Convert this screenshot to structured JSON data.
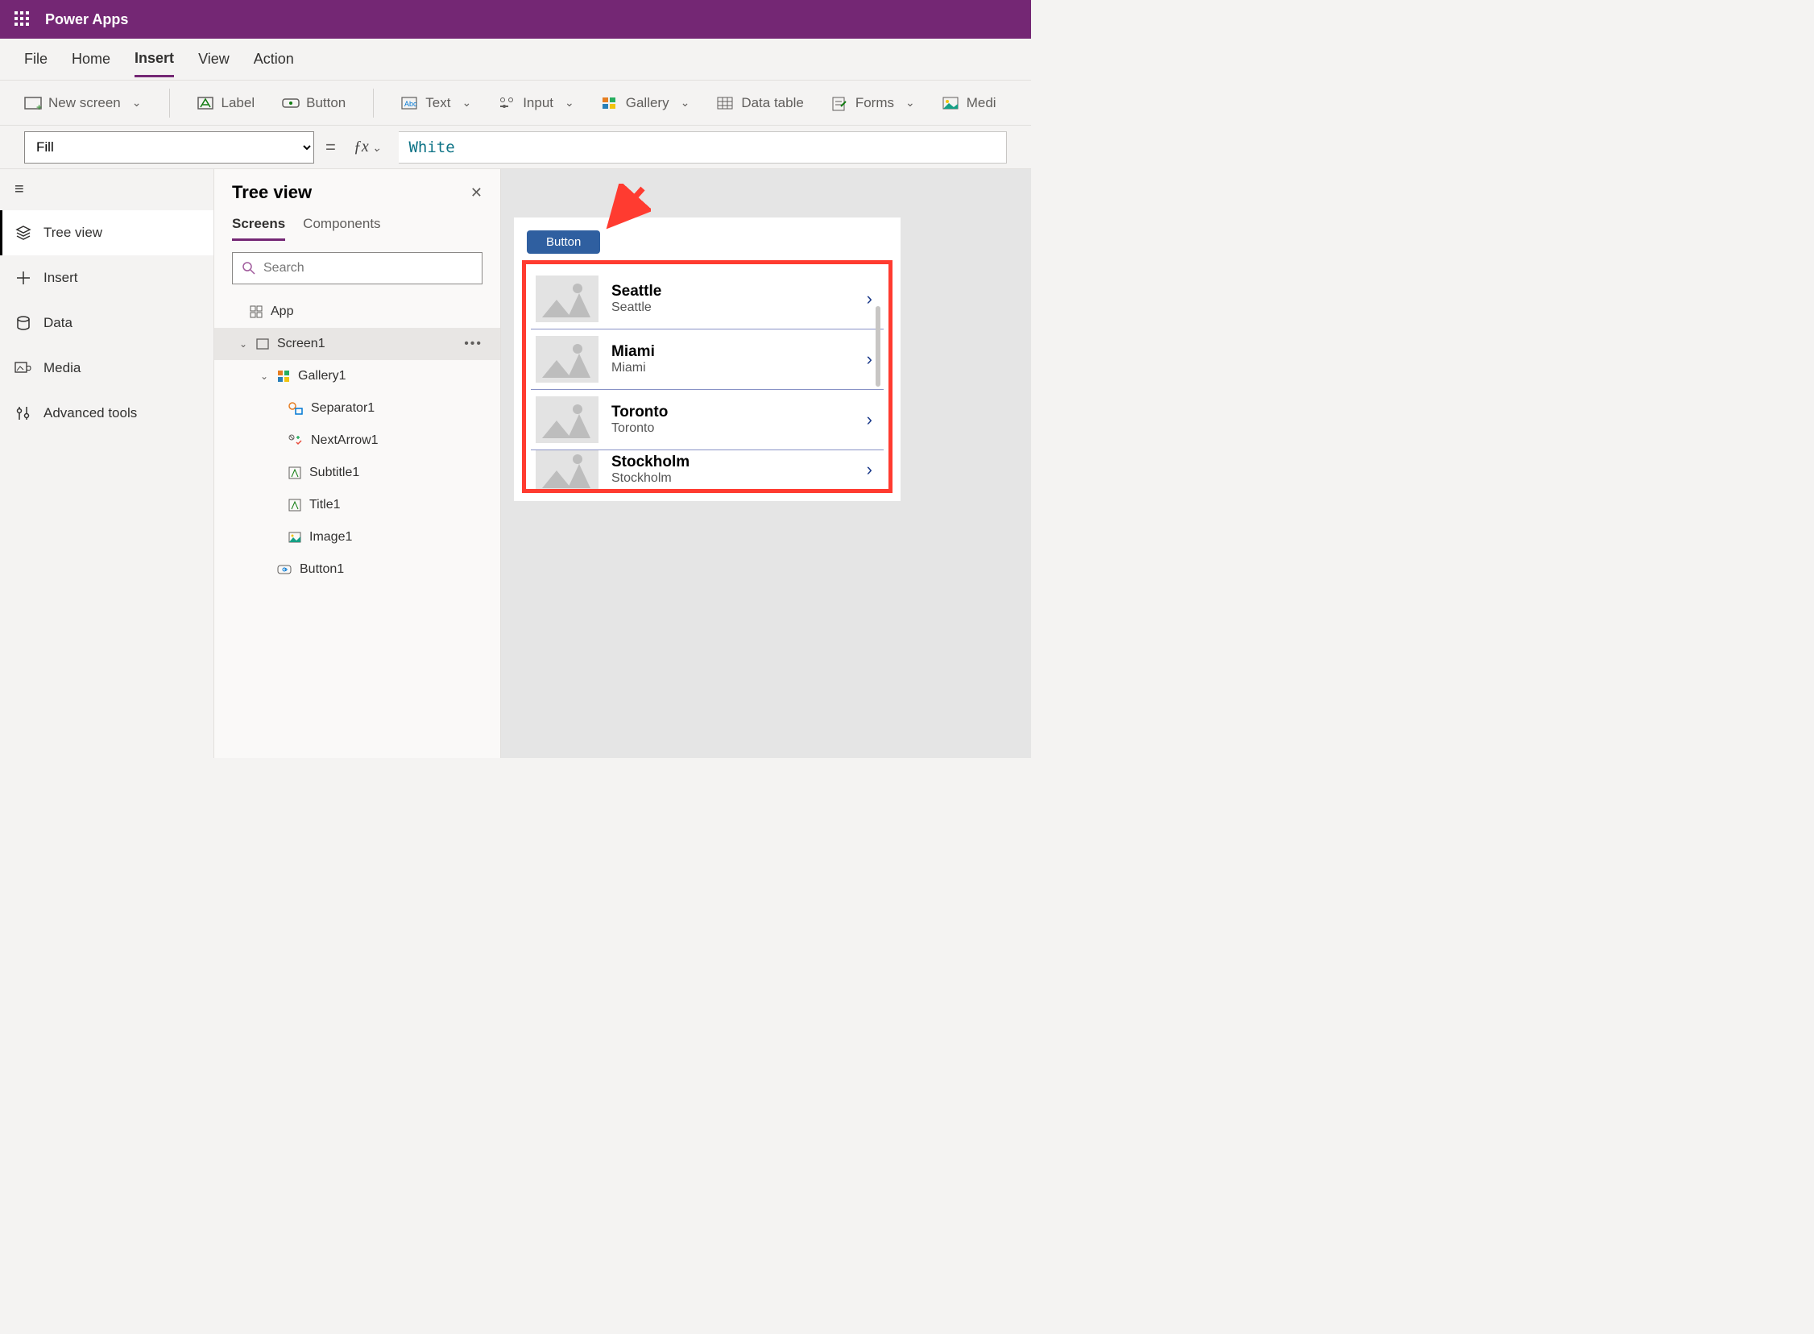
{
  "app": {
    "title": "Power Apps"
  },
  "menu": {
    "tabs": [
      "File",
      "Home",
      "Insert",
      "View",
      "Action"
    ],
    "active": 2
  },
  "ribbon": {
    "newscreen": "New screen",
    "label": "Label",
    "button": "Button",
    "text": "Text",
    "input": "Input",
    "gallery": "Gallery",
    "datatable": "Data table",
    "forms": "Forms",
    "media": "Medi"
  },
  "formula": {
    "property": "Fill",
    "value": "White"
  },
  "rail": {
    "items": [
      {
        "label": "Tree view"
      },
      {
        "label": "Insert"
      },
      {
        "label": "Data"
      },
      {
        "label": "Media"
      },
      {
        "label": "Advanced tools"
      }
    ]
  },
  "tree": {
    "title": "Tree view",
    "tabs": [
      "Screens",
      "Components"
    ],
    "search_placeholder": "Search",
    "nodes": {
      "app": "App",
      "screen1": "Screen1",
      "gallery1": "Gallery1",
      "separator1": "Separator1",
      "nextarrow1": "NextArrow1",
      "subtitle1": "Subtitle1",
      "title1": "Title1",
      "image1": "Image1",
      "button1": "Button1"
    }
  },
  "canvas": {
    "button_label": "Button",
    "gallery": [
      {
        "title": "Seattle",
        "subtitle": "Seattle"
      },
      {
        "title": "Miami",
        "subtitle": "Miami"
      },
      {
        "title": "Toronto",
        "subtitle": "Toronto"
      },
      {
        "title": "Stockholm",
        "subtitle": "Stockholm"
      }
    ]
  }
}
